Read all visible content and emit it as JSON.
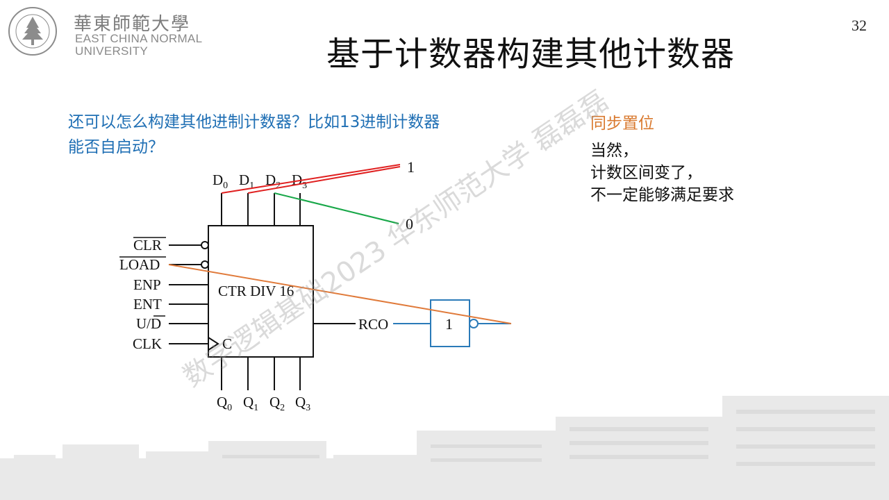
{
  "header": {
    "logo_cn": "華東師範大學",
    "logo_en_line1": "EAST CHINA NORMAL",
    "logo_en_line2": "UNIVERSITY",
    "page_number": "32"
  },
  "title": "基于计数器构建其他计数器",
  "question": {
    "line1": "还可以怎么构建其他进制计数器？比如13进制计数器",
    "line2": "能否自启动？"
  },
  "notes": {
    "title": "同步置位",
    "lines": [
      "当然，",
      "计数区间变了，",
      "不一定能够满足要求"
    ]
  },
  "circuit": {
    "chip_label": "CTR DIV 16",
    "clock_pin_label": "C",
    "gate_label": "1",
    "rco_label": "RCO",
    "const_one": "1",
    "const_zero": "0",
    "inputs_top": [
      "D",
      "D",
      "D",
      "D"
    ],
    "inputs_top_sub": [
      "0",
      "1",
      "2",
      "3"
    ],
    "outputs_bottom": [
      "Q",
      "Q",
      "Q",
      "Q"
    ],
    "outputs_bottom_sub": [
      "0",
      "1",
      "2",
      "3"
    ],
    "left_pins": {
      "clr": "CLR",
      "load": "LOAD",
      "enp": "ENP",
      "ent": "ENT",
      "ud_u": "U/",
      "ud_d": "D",
      "clk": "CLK"
    },
    "colors": {
      "wire": "#111111",
      "red": "#e02020",
      "green": "#1aa84a",
      "orange": "#e07a3a",
      "blue": "#2a7ab8"
    }
  },
  "watermark": "数字逻辑基础2023 华东师范大学 磊磊磊"
}
